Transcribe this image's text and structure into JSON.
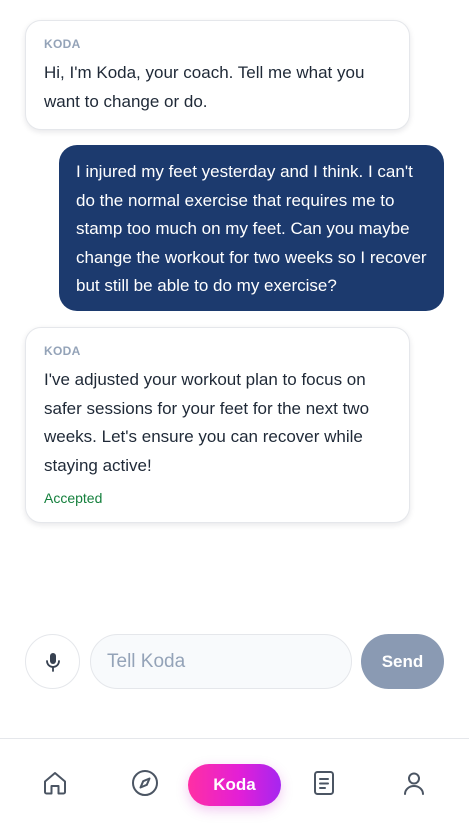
{
  "messages": [
    {
      "role": "coach",
      "sender": "KODA",
      "text": "Hi, I'm Koda, your coach. Tell me what you want to change or do."
    },
    {
      "role": "user",
      "text": "I injured my feet yesterday and I think. I can't do the normal exercise that requires me to stamp too much on my feet. Can you maybe change the workout for two weeks so I recover but still be able to do my exercise?"
    },
    {
      "role": "coach",
      "sender": "KODA",
      "text": "I've adjusted your workout plan to focus on safer sessions for your feet for the next two weeks. Let's ensure you can recover while staying active!",
      "status": "Accepted"
    }
  ],
  "composer": {
    "placeholder": "Tell Koda",
    "value": "",
    "send_label": "Send",
    "mic_icon": "microphone-icon"
  },
  "nav": {
    "items": [
      {
        "icon": "home-icon"
      },
      {
        "icon": "compass-icon"
      },
      {
        "label": "Koda"
      },
      {
        "icon": "document-icon"
      },
      {
        "icon": "user-icon"
      }
    ]
  },
  "colors": {
    "user_bubble": "#1c3a6e",
    "send_button": "#8a9ab3",
    "status_accepted": "#15803d",
    "koda_gradient_start": "#ff2fa4",
    "koda_gradient_end": "#a626f0"
  }
}
